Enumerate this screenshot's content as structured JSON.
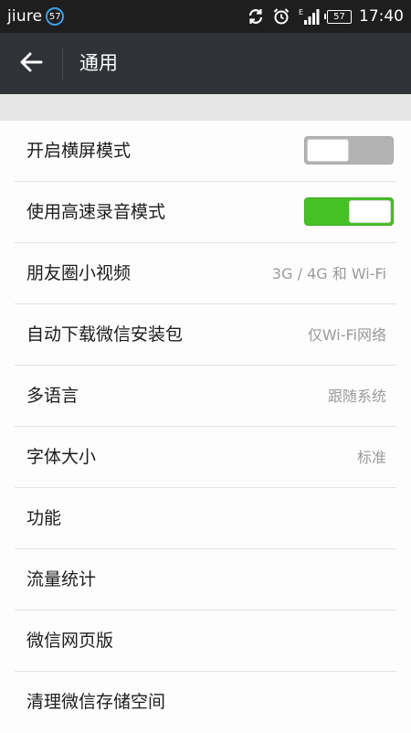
{
  "status_bar": {
    "carrier": "jiure",
    "badge": "57",
    "battery": "57",
    "time": "17:40",
    "icons": [
      "sync-icon",
      "alarm-icon",
      "signal-icon",
      "battery-icon"
    ],
    "badge_color": "#3aa0e8"
  },
  "header": {
    "title": "通用",
    "back_icon": "back-arrow-icon",
    "background": "#2f3237"
  },
  "settings": {
    "items": [
      {
        "label": "开启横屏模式",
        "toggle": "off"
      },
      {
        "label": "使用高速录音模式",
        "toggle": "on"
      },
      {
        "label": "朋友圈小视频",
        "value": "3G / 4G 和 Wi-Fi"
      },
      {
        "label": "自动下载微信安装包",
        "value": "仅Wi-Fi网络"
      },
      {
        "label": "多语言",
        "value": "跟随系统"
      },
      {
        "label": "字体大小",
        "value": "标准"
      },
      {
        "label": "功能"
      },
      {
        "label": "流量统计"
      },
      {
        "label": "微信网页版"
      },
      {
        "label": "清理微信存储空间"
      }
    ],
    "toggle_on_color": "#47c026",
    "toggle_off_color": "#b3b3b3"
  }
}
